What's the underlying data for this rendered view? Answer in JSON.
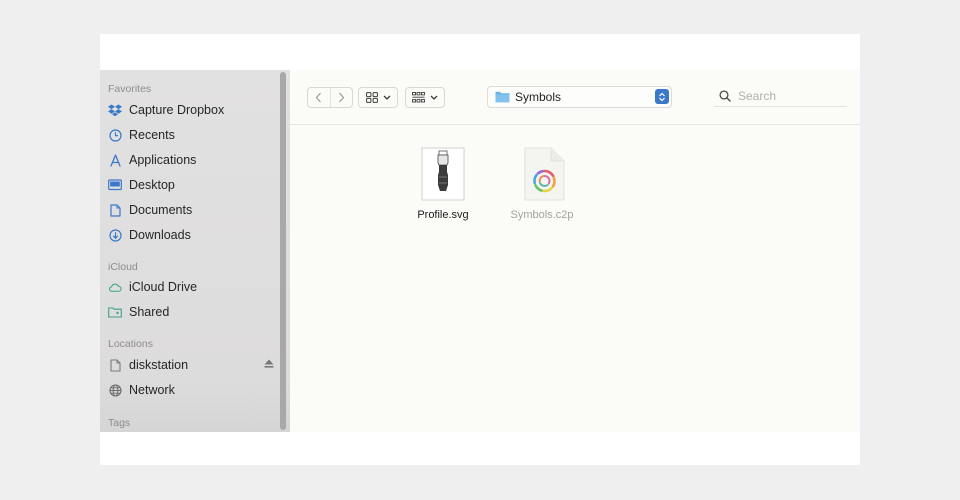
{
  "sidebar": {
    "sections": [
      {
        "header": "Favorites",
        "items": [
          {
            "label": "Capture Dropbox",
            "icon": "dropbox-icon"
          },
          {
            "label": "Recents",
            "icon": "clock-icon"
          },
          {
            "label": "Applications",
            "icon": "applications-icon"
          },
          {
            "label": "Desktop",
            "icon": "desktop-icon"
          },
          {
            "label": "Documents",
            "icon": "document-icon"
          },
          {
            "label": "Downloads",
            "icon": "downloads-icon"
          }
        ]
      },
      {
        "header": "iCloud",
        "items": [
          {
            "label": "iCloud Drive",
            "icon": "cloud-icon"
          },
          {
            "label": "Shared",
            "icon": "shared-folder-icon"
          }
        ]
      },
      {
        "header": "Locations",
        "items": [
          {
            "label": "diskstation",
            "icon": "document-icon"
          },
          {
            "label": "Network",
            "icon": "globe-icon"
          }
        ]
      },
      {
        "header": "Tags",
        "items": []
      }
    ]
  },
  "toolbar": {
    "path": "Symbols",
    "search_placeholder": "Search"
  },
  "files": [
    {
      "name": "Profile.svg"
    },
    {
      "name": "Symbols.c2p"
    }
  ],
  "colors": {
    "accent": "#3b78c8",
    "sidebar_icon": "#3a78c9",
    "folder": "#6ab3e3"
  }
}
